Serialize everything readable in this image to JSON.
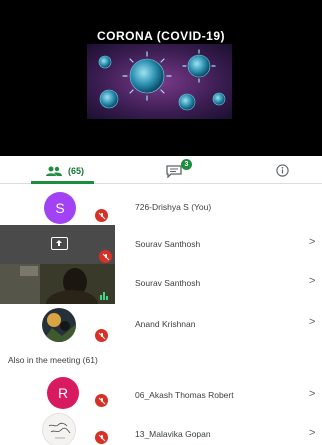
{
  "presentation": {
    "title": "CORONA (COVID-19)"
  },
  "tabs": {
    "people_count": "(65)",
    "chat_badge": "3"
  },
  "participants": [
    {
      "name": "726-Drishya S (You)",
      "avatar_letter": "S",
      "avatar_color": "#a142f4"
    },
    {
      "name": "Sourav Santhosh"
    },
    {
      "name": "Sourav Santhosh"
    },
    {
      "name": "Anand Krishnan"
    }
  ],
  "also_section": {
    "label": "Also in the meeting (61)",
    "items": [
      {
        "name": "06_Akash Thomas Robert",
        "avatar_letter": "R",
        "avatar_color": "#d81b60"
      },
      {
        "name": "13_Malavika Gopan"
      }
    ]
  },
  "chevron": ">",
  "colors": {
    "accent": "#1e8e3e",
    "mic_off": "#d93025",
    "presentation_bg": "#000000"
  }
}
